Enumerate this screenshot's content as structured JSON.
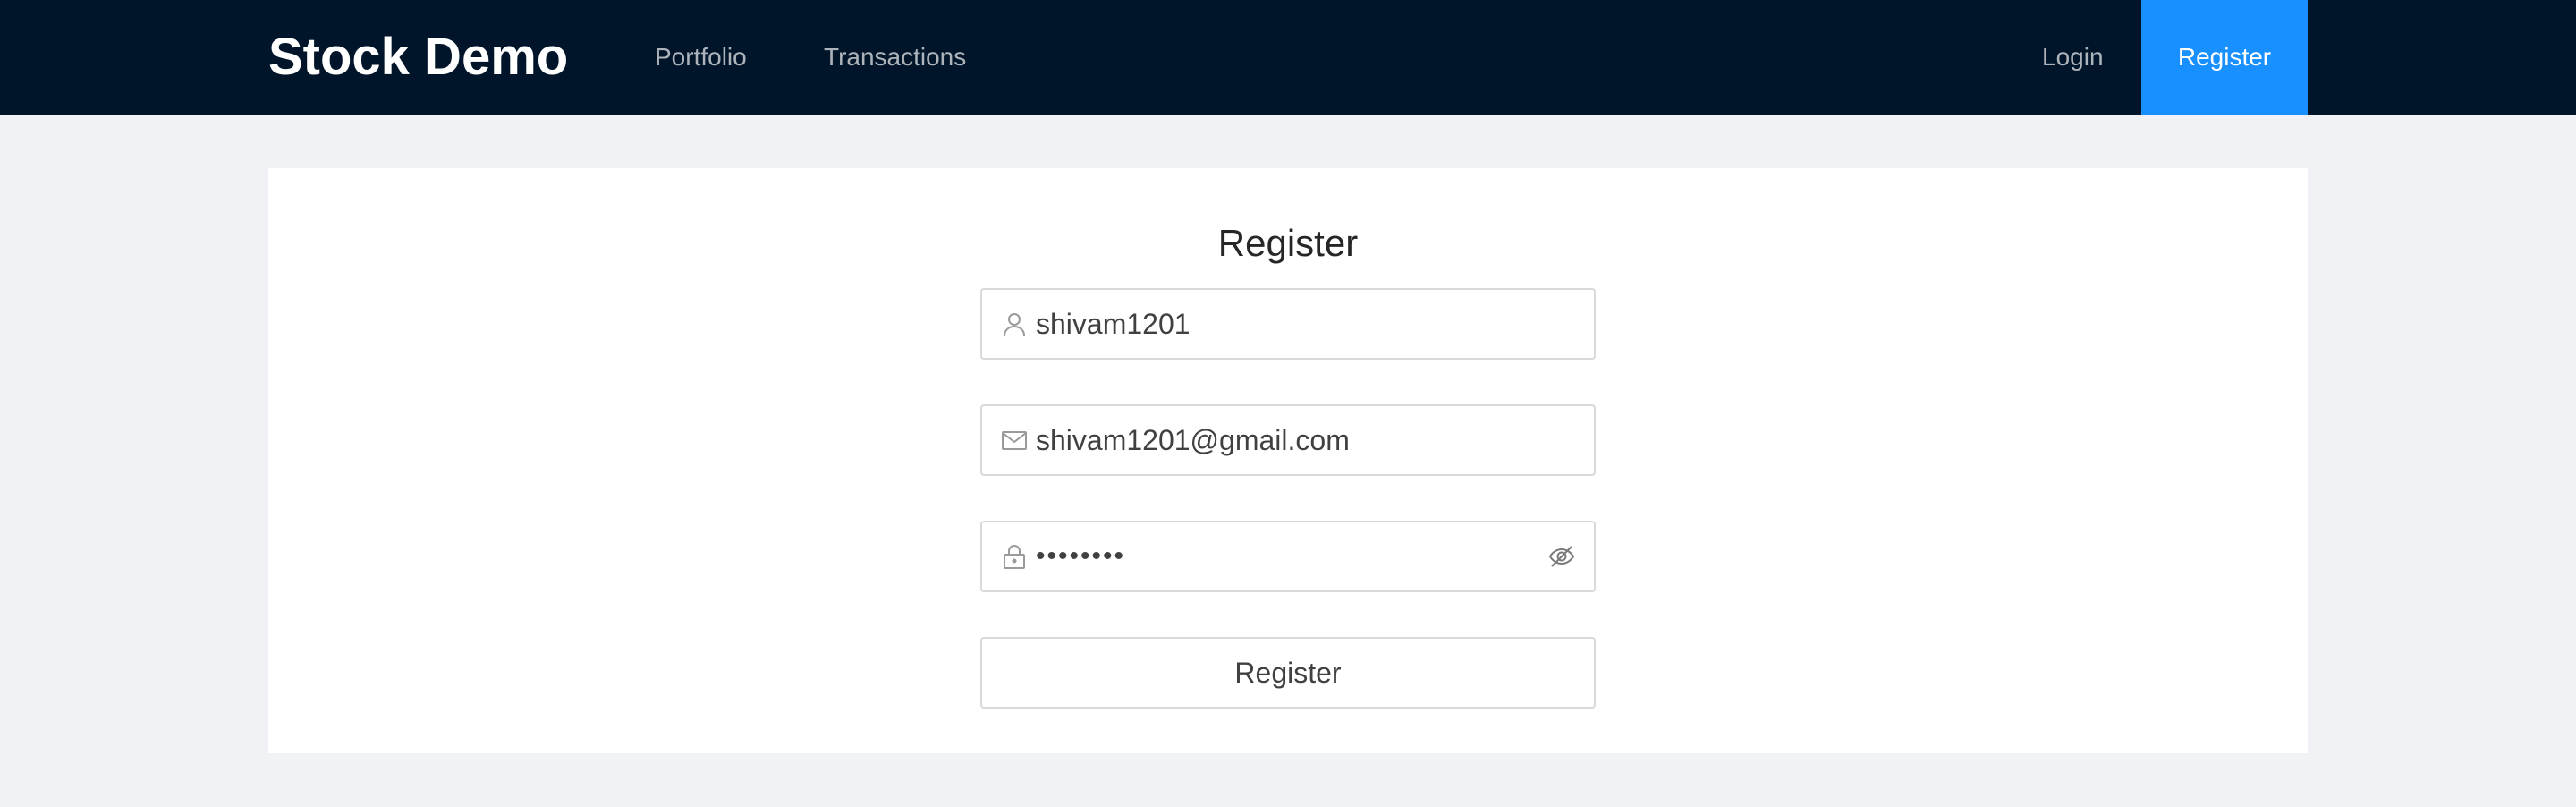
{
  "header": {
    "brand": "Stock Demo",
    "nav": {
      "portfolio": "Portfolio",
      "transactions": "Transactions",
      "login": "Login",
      "register": "Register"
    },
    "active_item": "register",
    "colors": {
      "background": "#001529",
      "active": "#1890ff"
    }
  },
  "form": {
    "title": "Register",
    "username": {
      "value": "shivam1201",
      "icon": "user-icon"
    },
    "email": {
      "value": "shivam1201@gmail.com",
      "icon": "mail-icon"
    },
    "password": {
      "masked_value": "••••••••",
      "icon": "lock-icon",
      "toggle_icon": "eye-invisible-icon"
    },
    "submit_label": "Register"
  }
}
